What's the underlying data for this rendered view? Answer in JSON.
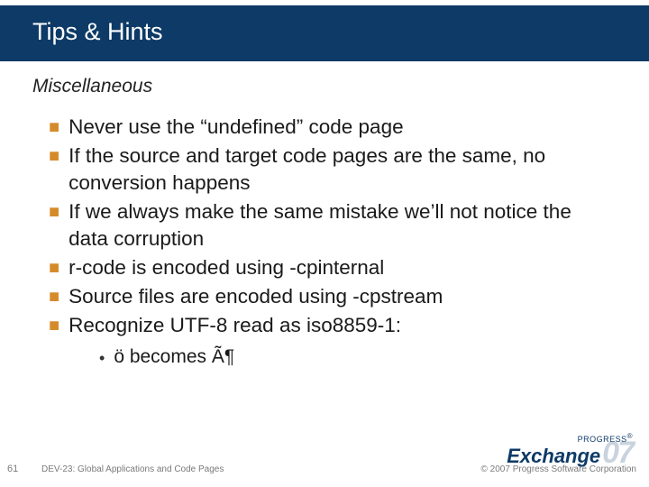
{
  "title": "Tips & Hints",
  "subhead": "Miscellaneous",
  "bullets": [
    "Never use the “undefined” code page",
    "If the source and target code pages are the same, no conversion happens",
    "If we always make the same mistake we’ll not notice the data corruption",
    "r-code is encoded using -cpinternal",
    "Source files are encoded using -cpstream",
    "Recognize UTF-8 read as iso8859-1:"
  ],
  "sub_bullet": "ö becomes Ã¶",
  "page_number": "61",
  "footer_left": "DEV-23: Global Applications and Code Pages",
  "footer_right": "© 2007 Progress Software Corporation",
  "logo": {
    "top": "PROGRESS",
    "main": "Exchange",
    "year": "07",
    "reg": "®"
  },
  "bullet_marker": "■",
  "dot_marker": "•"
}
